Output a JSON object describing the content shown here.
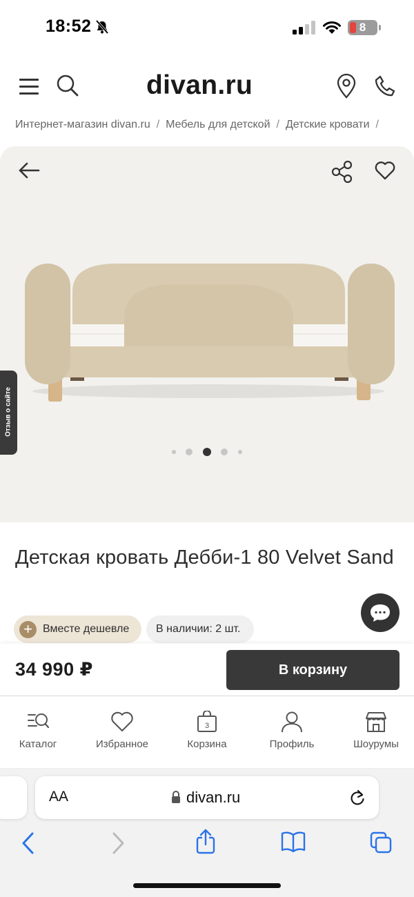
{
  "status_bar": {
    "time": "18:52",
    "battery": "8",
    "battery_color": "#e5453c"
  },
  "header": {
    "logo": "divan.ru",
    "icons": [
      "menu-icon",
      "search-icon",
      "location-pin-icon",
      "phone-icon"
    ]
  },
  "breadcrumb": [
    "Интернет-магазин divan.ru",
    "Мебель для детской",
    "Детские кровати"
  ],
  "gallery": {
    "slide_count": 5,
    "active_slide": 3,
    "background": "#f2f1ee",
    "icons": [
      "back-arrow-icon",
      "share-icon",
      "heart-icon"
    ]
  },
  "review_tab": "Отзыв о сайте",
  "product": {
    "title": "Детская кровать Дебби-1 80 Velvet Sand",
    "badge_cheaper": "Вместе дешевле",
    "badge_stock": "В наличии: 2 шт.",
    "price": "34 990 ₽",
    "cart_button": "В корзину",
    "fabric_color": "#d9cbb0"
  },
  "bottom_nav": [
    {
      "label": "Каталог",
      "icon": "catalog-search-icon"
    },
    {
      "label": "Избранное",
      "icon": "heart-icon"
    },
    {
      "label": "Корзина",
      "icon": "shopping-bag-icon",
      "count": "3"
    },
    {
      "label": "Профиль",
      "icon": "user-icon"
    },
    {
      "label": "Шоурумы",
      "icon": "store-icon"
    }
  ],
  "browser": {
    "text_size_label": "AA",
    "url": "divan.ru"
  }
}
